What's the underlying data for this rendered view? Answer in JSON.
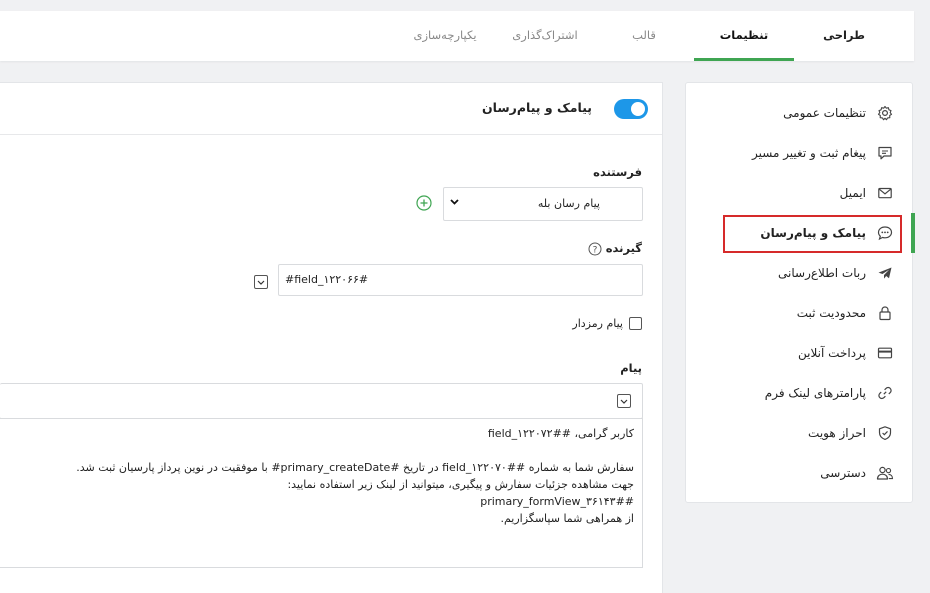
{
  "top_tabs": [
    {
      "label": "طراحی"
    },
    {
      "label": "تنظیمات"
    },
    {
      "label": "قالب"
    },
    {
      "label": "اشتراک‌گذاری"
    },
    {
      "label": "یکپارچه‌سازی"
    }
  ],
  "sidebar": {
    "items": [
      {
        "label": "تنظیمات عمومی",
        "icon": "gear-icon"
      },
      {
        "label": "پیغام ثبت و تغییر مسیر",
        "icon": "message-icon"
      },
      {
        "label": "ایمیل",
        "icon": "mail-icon"
      },
      {
        "label": "پیامک و پیام‌رسان",
        "icon": "chat-icon"
      },
      {
        "label": "ربات اطلاع‌رسانی",
        "icon": "telegram-icon"
      },
      {
        "label": "محدودیت ثبت",
        "icon": "lock-icon"
      },
      {
        "label": "پرداخت آنلاین",
        "icon": "card-icon"
      },
      {
        "label": "پارامترهای لینک فرم",
        "icon": "link-icon"
      },
      {
        "label": "احراز هویت",
        "icon": "shield-icon"
      },
      {
        "label": "دسترسی",
        "icon": "users-icon"
      }
    ]
  },
  "main": {
    "header_title": "پیامک و پیام‌رسان",
    "toggle_on": true,
    "sender_label": "فرستنده",
    "sender_value": "پیام رسان بله",
    "receiver_label": "گیرنده",
    "receiver_value": "#field_۱۲۲۰۶۶#",
    "secret_label": "پیام رمزدار",
    "message_label": "پیام",
    "message_lines": [
      "کاربر گرامی، ##field_۱۲۲۰۷۲",
      "",
      "سفارش شما به شماره ##field_۱۲۲۰۷۰ در تاریخ #primary_createDate# با موفقیت در نوین پرداز پارسیان ثبت شد.",
      "جهت مشاهده جزئیات سفارش و پیگیری، میتوانید از لینک زیر استفاده نمایید:",
      "##primary_formView_۳۶۱۴۳",
      "از همراهی شما سپاسگزاریم."
    ]
  },
  "colors": {
    "accent_green": "#3fa552",
    "toggle_blue": "#1d97e8",
    "highlight_red": "#d62a2a"
  }
}
